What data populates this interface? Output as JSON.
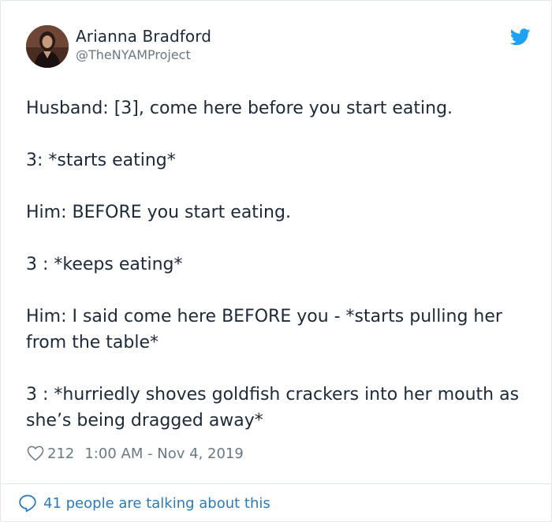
{
  "author": {
    "name": "Arianna Bradford",
    "handle": "@TheNYAMProject",
    "avatar_icon": "profile-photo"
  },
  "brand": {
    "icon": "twitter-bird-icon",
    "color": "#1da1f2"
  },
  "tweet": {
    "paragraphs": [
      "Husband: [3], come here before you start eating.",
      "3: *starts eating*",
      "Him: BEFORE you start eating.",
      "3 : *keeps eating*",
      "Him: I said come here BEFORE you - *starts pulling her from the table*",
      "3 : *hurriedly shoves goldfish crackers into her mouth as she’s being dragged away*"
    ]
  },
  "meta": {
    "like_icon": "heart-icon",
    "likes": "212",
    "timestamp": "1:00 AM - Nov 4, 2019"
  },
  "footer": {
    "icon": "speech-bubble-icon",
    "text": "41 people are talking about this",
    "link_color": "#2b7bb9"
  }
}
